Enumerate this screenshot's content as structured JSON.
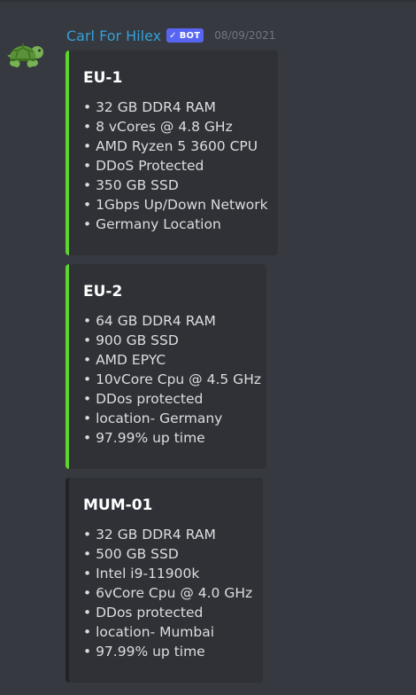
{
  "message": {
    "author": "Carl For Hilex",
    "bot_tag": "BOT",
    "bot_check_icon": "checkmark-icon",
    "timestamp": "08/09/2021",
    "avatar_icon": "turtle-avatar-icon"
  },
  "colors": {
    "background": "#36393f",
    "embed_background": "#2f3136",
    "username": "#34a0d8",
    "bot_tag": "#5865f2",
    "embed_accent_green": "#5fd431",
    "embed_accent_dark": "#202225"
  },
  "embeds": [
    {
      "title": "EU-1",
      "lines": [
        "• 32 GB DDR4 RAM",
        "• 8 vCores @ 4.8 GHz",
        "• AMD Ryzen 5 3600 CPU",
        "• DDoS Protected",
        "• 350 GB SSD",
        "• 1Gbps Up/Down Network",
        "• Germany Location"
      ]
    },
    {
      "title": "EU-2",
      "lines": [
        "• 64 GB DDR4 RAM",
        "• 900 GB SSD",
        "• AMD EPYC",
        "• 10vCore Cpu @ 4.5 GHz",
        "• DDos protected",
        "• location- Germany",
        "• 97.99% up time"
      ]
    },
    {
      "title": "MUM-01",
      "lines": [
        "• 32 GB DDR4 RAM",
        "• 500 GB SSD",
        "• Intel i9-11900k",
        "• 6vCore Cpu @ 4.0 GHz",
        "• DDos protected",
        "• location- Mumbai",
        "• 97.99% up time"
      ]
    }
  ]
}
